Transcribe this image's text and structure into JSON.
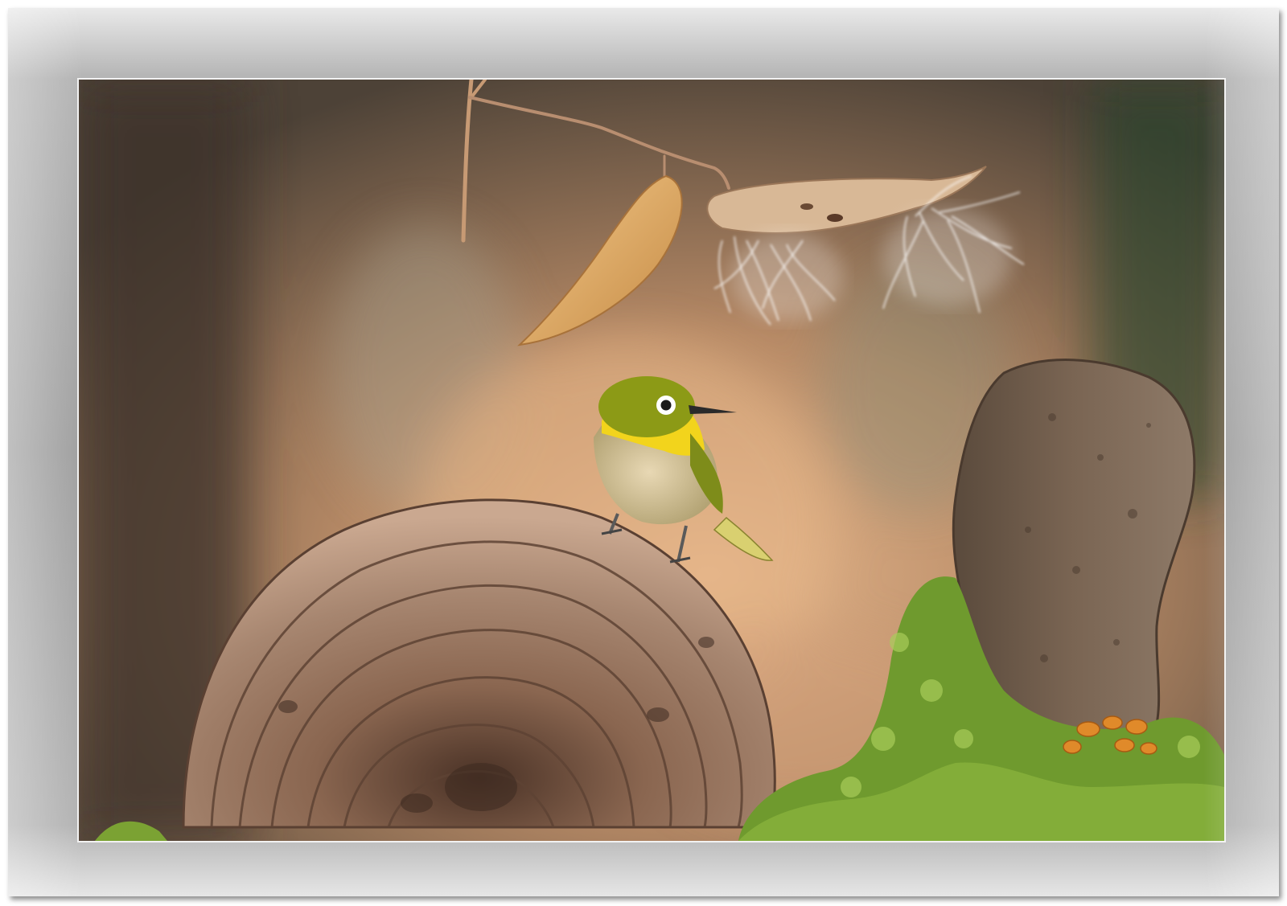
{
  "image": {
    "subject": "",
    "colors": {
      "frame": "#a8a8a8",
      "background_warm": "#c99d78",
      "background_dark": "#4f4436",
      "background_green": "#3e5a38",
      "bird_green": "#8a9a1a",
      "bird_yellow": "#f0d21a",
      "fungus": "#8c6a55",
      "moss": "#6f9a2e",
      "rock": "#6e5a4a"
    }
  }
}
